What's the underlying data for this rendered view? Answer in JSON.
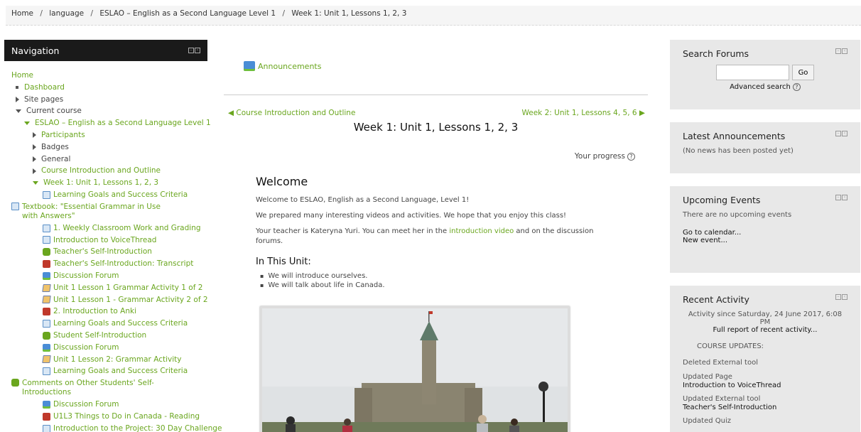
{
  "breadcrumb": [
    "Home",
    "language",
    "ESLAO – English as a Second Language Level 1",
    "Week 1: Unit 1, Lessons 1, 2, 3"
  ],
  "navigation": {
    "title": "Navigation",
    "items": [
      {
        "label": "Home",
        "level": 0,
        "type": "link"
      },
      {
        "label": "Dashboard",
        "level": 1,
        "type": "bullet-link"
      },
      {
        "label": "Site pages",
        "level": 1,
        "type": "collapsed"
      },
      {
        "label": "Current course",
        "level": 1,
        "type": "expanded"
      },
      {
        "label": "ESLAO – English as a Second Language Level 1",
        "level": 2,
        "type": "expanded-link"
      },
      {
        "label": "Participants",
        "level": 3,
        "type": "collapsed-link"
      },
      {
        "label": "Badges",
        "level": 3,
        "type": "collapsed"
      },
      {
        "label": "General",
        "level": 3,
        "type": "collapsed"
      },
      {
        "label": "Course Introduction and Outline",
        "level": 3,
        "type": "collapsed-link"
      },
      {
        "label": "Week 1: Unit 1, Lessons 1, 2, 3",
        "level": 3,
        "type": "expanded-link"
      },
      {
        "label": "Learning Goals and Success Criteria",
        "level": 4,
        "icon": "page-icon"
      },
      {
        "label": "Textbook: \"Essential Grammar in Use with Answers\"",
        "level": 4,
        "icon": "page-icon",
        "wrap": true
      },
      {
        "label": "1. Weekly Classroom Work and Grading",
        "level": 4,
        "icon": "page-icon"
      },
      {
        "label": "Introduction to VoiceThread",
        "level": 4,
        "icon": "page-icon"
      },
      {
        "label": "Teacher's Self-Introduction",
        "level": 4,
        "icon": "puzzle-icon"
      },
      {
        "label": "Teacher's Self-Introduction: Transcript",
        "level": 4,
        "icon": "pdf-icon"
      },
      {
        "label": "Discussion Forum",
        "level": 4,
        "icon": "forum-icon"
      },
      {
        "label": "Unit 1 Lesson 1 Grammar Activity 1 of 2",
        "level": 4,
        "icon": "quiz-icon"
      },
      {
        "label": "Unit 1 Lesson 1 - Grammar Activity 2 of 2",
        "level": 4,
        "icon": "quiz-icon"
      },
      {
        "label": "2. Introduction to Anki",
        "level": 4,
        "icon": "pdf-icon"
      },
      {
        "label": "Learning Goals and Success Criteria",
        "level": 4,
        "icon": "page-icon"
      },
      {
        "label": "Student Self-Introduction",
        "level": 4,
        "icon": "puzzle-icon"
      },
      {
        "label": "Discussion Forum",
        "level": 4,
        "icon": "forum-icon"
      },
      {
        "label": "Unit 1 Lesson 2: Grammar Activity",
        "level": 4,
        "icon": "quiz-icon"
      },
      {
        "label": "Learning Goals and Success Criteria",
        "level": 4,
        "icon": "page-icon"
      },
      {
        "label": "Comments on Other Students' Self-Introductions",
        "level": 4,
        "icon": "puzzle-icon",
        "wrap": true
      },
      {
        "label": "Discussion Forum",
        "level": 4,
        "icon": "forum-icon"
      },
      {
        "label": "U1L3 Things to Do in Canada - Reading",
        "level": 4,
        "icon": "pdf-icon"
      },
      {
        "label": "Introduction to the Project: 30 Day Challenge",
        "level": 4,
        "icon": "page-icon"
      }
    ]
  },
  "main": {
    "announcements": "Announcements",
    "prev_section": "◀ Course Introduction and Outline",
    "next_section": "Week 2: Unit 1, Lessons 4, 5, 6 ▶",
    "section_title": "Week 1: Unit 1, Lessons 1, 2, 3",
    "progress_label": "Your progress",
    "summary": {
      "heading": "Welcome",
      "p1": "Welcome to ESLAO, English as a Second Language, Level 1!",
      "p2": "We prepared many interesting videos and activities. We hope that you enjoy this class!",
      "p3_before": "Your teacher is Kateryna Yuri. You can meet her in the ",
      "p3_link": "introduction video",
      "p3_after": " and on the discussion forums.",
      "unit_heading": "In This Unit:",
      "unit_items": [
        "We will introduce ourselves.",
        "We will talk about life in Canada."
      ]
    }
  },
  "search_forums": {
    "title": "Search Forums",
    "input_value": "",
    "go_label": "Go",
    "advanced_label": "Advanced search"
  },
  "latest_announcements": {
    "title": "Latest Announcements",
    "empty_text": "(No news has been posted yet)"
  },
  "upcoming_events": {
    "title": "Upcoming Events",
    "empty_text": "There are no upcoming events",
    "calendar_link": "Go to calendar...",
    "new_event_link": "New event..."
  },
  "recent_activity": {
    "title": "Recent Activity",
    "since": "Activity since Saturday, 24 June 2017, 6:08 PM",
    "full_report": "Full report of recent activity...",
    "updates_heading": "COURSE UPDATES:",
    "updates": [
      {
        "action": "Deleted External tool",
        "item": ""
      },
      {
        "action": "Updated Page",
        "item": "Introduction to VoiceThread"
      },
      {
        "action": "Updated External tool",
        "item": "Teacher's Self-Introduction"
      },
      {
        "action": "Updated Quiz",
        "item": ""
      }
    ]
  },
  "colors": {
    "link": "#6aa61e",
    "nav_header": "#1a1a1a",
    "block_bg": "#e8e8e8"
  }
}
